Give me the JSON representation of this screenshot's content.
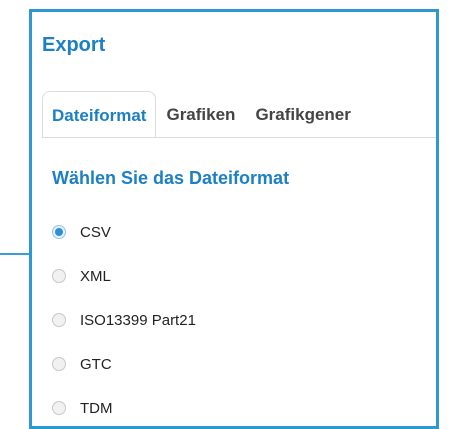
{
  "dialog": {
    "title": "Export",
    "tabs": [
      {
        "label": "Dateiformat",
        "active": true
      },
      {
        "label": "Grafiken",
        "active": false
      },
      {
        "label": "Grafikgener",
        "active": false
      }
    ],
    "section_title": "Wählen Sie das Dateiformat",
    "options": [
      {
        "label": "CSV",
        "selected": true
      },
      {
        "label": "XML",
        "selected": false
      },
      {
        "label": "ISO13399 Part21",
        "selected": false
      },
      {
        "label": "GTC",
        "selected": false
      },
      {
        "label": "TDM",
        "selected": false
      }
    ]
  },
  "colors": {
    "accent": "#1d80c4",
    "border": "#2f97d4"
  }
}
